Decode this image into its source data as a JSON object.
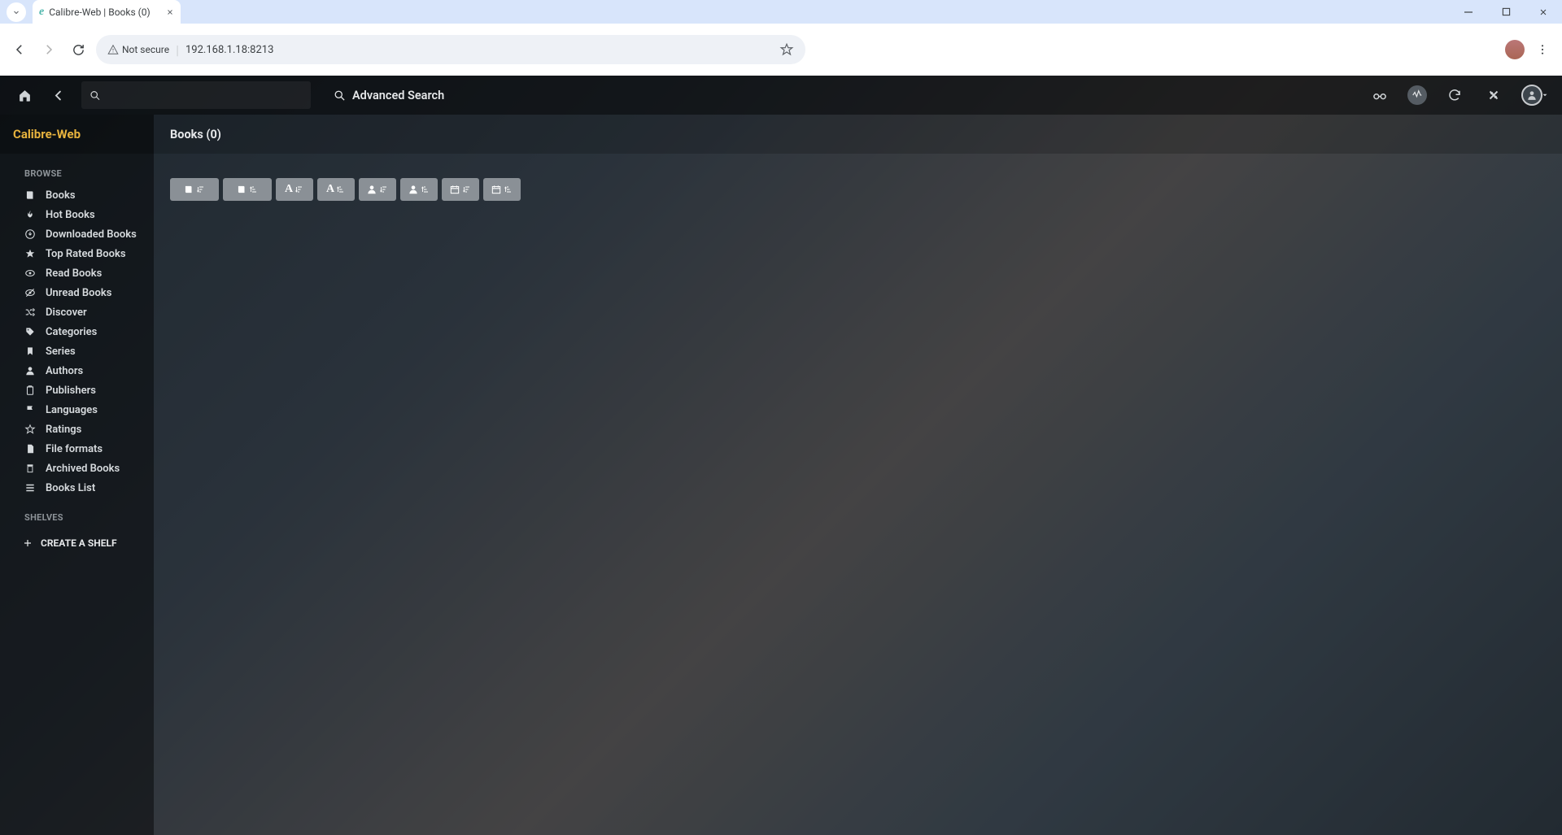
{
  "browser": {
    "tab_title": "Calibre-Web | Books (0)",
    "security_label": "Not secure",
    "url": "192.168.1.18:8213"
  },
  "app": {
    "advanced_search": "Advanced Search",
    "brand": "Calibre-Web",
    "content_title": "Books (0)",
    "sidebar": {
      "browse_label": "BROWSE",
      "shelves_label": "SHELVES",
      "create_shelf": "CREATE A SHELF",
      "items": [
        {
          "label": "Books",
          "icon": "book"
        },
        {
          "label": "Hot Books",
          "icon": "flame"
        },
        {
          "label": "Downloaded Books",
          "icon": "download"
        },
        {
          "label": "Top Rated Books",
          "icon": "star"
        },
        {
          "label": "Read Books",
          "icon": "eye"
        },
        {
          "label": "Unread Books",
          "icon": "eye-off"
        },
        {
          "label": "Discover",
          "icon": "shuffle"
        },
        {
          "label": "Categories",
          "icon": "tag"
        },
        {
          "label": "Series",
          "icon": "bookmark"
        },
        {
          "label": "Authors",
          "icon": "user"
        },
        {
          "label": "Publishers",
          "icon": "building"
        },
        {
          "label": "Languages",
          "icon": "flag"
        },
        {
          "label": "Ratings",
          "icon": "star-outline"
        },
        {
          "label": "File formats",
          "icon": "file"
        },
        {
          "label": "Archived Books",
          "icon": "archive"
        },
        {
          "label": "Books List",
          "icon": "list"
        }
      ]
    },
    "sort_buttons": [
      {
        "icon": "book",
        "dir": "desc"
      },
      {
        "icon": "book",
        "dir": "asc"
      },
      {
        "icon": "letter",
        "dir": "desc"
      },
      {
        "icon": "letter",
        "dir": "asc"
      },
      {
        "icon": "user",
        "dir": "desc"
      },
      {
        "icon": "user",
        "dir": "asc"
      },
      {
        "icon": "date",
        "dir": "desc"
      },
      {
        "icon": "date",
        "dir": "asc"
      }
    ]
  }
}
